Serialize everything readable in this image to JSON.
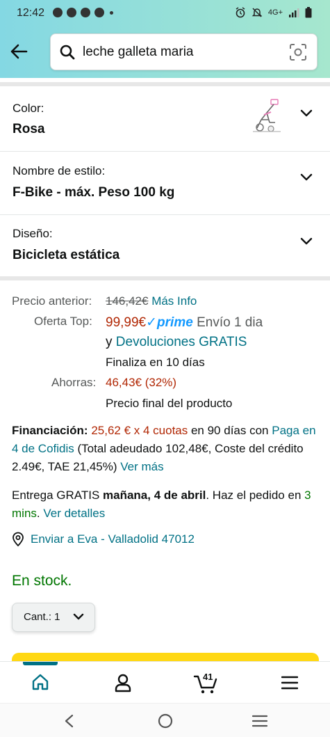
{
  "status_bar": {
    "time": "12:42",
    "network": "4G+"
  },
  "header": {
    "search_query": "leche galleta maria"
  },
  "variations": [
    {
      "label": "Color:",
      "value": "Rosa"
    },
    {
      "label": "Nombre de estilo:",
      "value": "F-Bike - máx. Peso 100 kg"
    },
    {
      "label": "Diseño:",
      "value": "Bicicleta estática"
    }
  ],
  "price": {
    "previous_label": "Precio anterior:",
    "previous_value": "146,42€",
    "more_info": "Más Info",
    "offer_label": "Oferta Top:",
    "offer_value": "99,99€",
    "prime_check": "✓",
    "prime_word": "prime",
    "shipping": "Envío 1 dia",
    "and": "y",
    "returns": "Devoluciones GRATIS",
    "ends": "Finaliza en 10 días",
    "savings_label": "Ahorras:",
    "savings_value": "46,43€ (32%)",
    "final_note": "Precio final del producto"
  },
  "financing": {
    "label": "Financiación:",
    "installments": "25,62 € x 4 cuotas",
    "term": " en 90 días con ",
    "provider": "Paga en 4 de Cofidis",
    "details": " (Total adeudado 102,48€, Coste del crédito 2.49€, TAE 21,45%) ",
    "see_more": "Ver más"
  },
  "delivery": {
    "prefix": "Entrega GRATIS ",
    "date": "mañana, 4 de abril",
    "middle": ". Haz el pedido en ",
    "countdown": "3 mins",
    "suffix": ". ",
    "details_link": "Ver detalles"
  },
  "ship_to": "Enviar a Eva - Valladolid 47012",
  "stock": "En stock.",
  "quantity": {
    "label": "Cant.: 1"
  },
  "nav": {
    "cart_count": "41"
  },
  "colors": {
    "header_gradient_start": "#84d8e3",
    "header_gradient_end": "#a6e7ce",
    "link": "#007185",
    "price_red": "#b12704",
    "in_stock_green": "#007600",
    "buy_yellow": "#ffd814",
    "prime_blue": "#1399ff"
  },
  "icons": [
    "back-arrow-icon",
    "search-icon",
    "camera-icon",
    "chevron-down-icon",
    "location-pin-icon",
    "home-icon",
    "account-icon",
    "cart-icon",
    "menu-icon",
    "system-back-icon",
    "system-home-icon",
    "system-recents-icon"
  ]
}
